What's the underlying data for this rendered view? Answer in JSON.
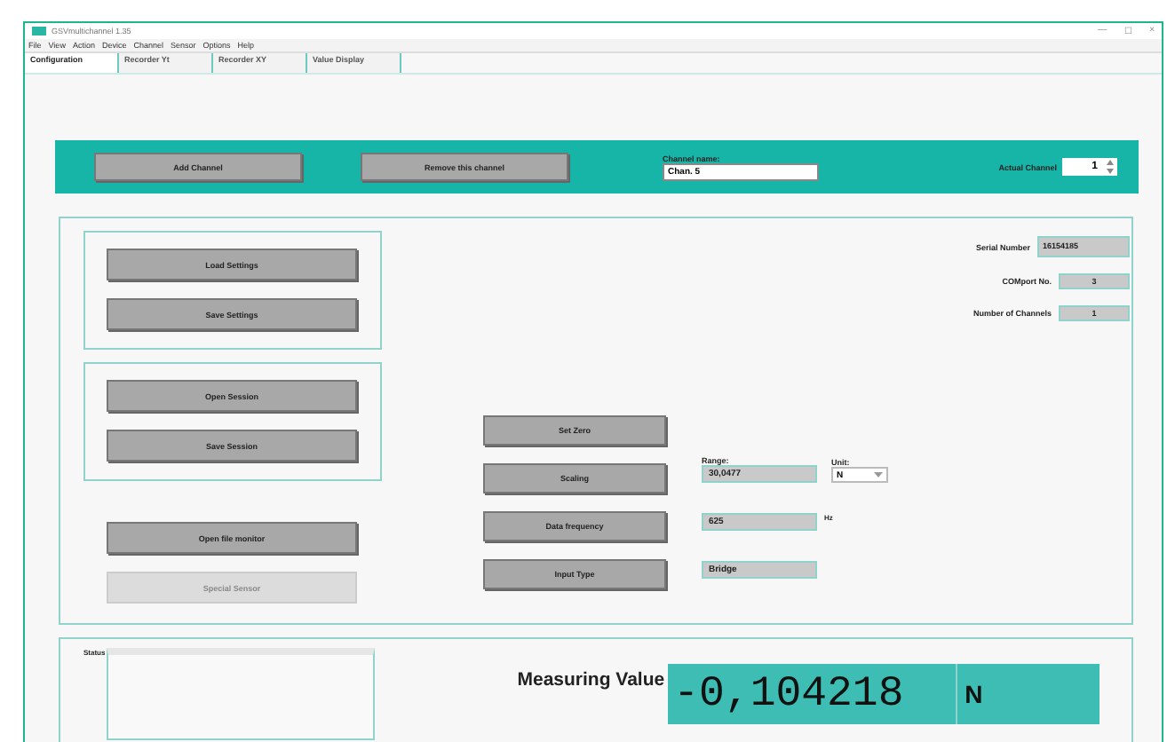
{
  "window": {
    "title": "GSVmultichannel 1.35",
    "controls": [
      "—",
      "☐",
      "×"
    ]
  },
  "menu": [
    "File",
    "View",
    "Action",
    "Device",
    "Channel",
    "Sensor",
    "Options",
    "Help"
  ],
  "tabs": [
    {
      "label": "Configuration",
      "selected": true
    },
    {
      "label": "Recorder Yt",
      "selected": false
    },
    {
      "label": "Recorder XY",
      "selected": false
    },
    {
      "label": "Value Display",
      "selected": false
    }
  ],
  "channel_bar": {
    "buttons": [
      "Add Channel",
      "Remove this channel"
    ],
    "channel_name": {
      "label": "Channel name:",
      "value": "Chan. 5"
    },
    "actual_channel": {
      "label": "Actual Channel",
      "value": "1"
    }
  },
  "settings": {
    "groups": [
      {
        "buttons": [
          {
            "label": "Load Settings",
            "disabled": false
          },
          {
            "label": "Save Settings",
            "disabled": false
          }
        ]
      },
      {
        "buttons": [
          {
            "label": "Open Session",
            "disabled": false
          },
          {
            "label": "Save Session",
            "disabled": false
          }
        ]
      }
    ],
    "buttons": [
      {
        "label": "Open file monitor",
        "disabled": false
      },
      {
        "label": "Special Sensor",
        "disabled": true
      }
    ]
  },
  "device_info": [
    {
      "label": "Serial Number",
      "value": "16154185"
    },
    {
      "label": "COMport No.",
      "value": "3"
    },
    {
      "label": "Number of Channels",
      "value": "1"
    }
  ],
  "sensor": {
    "rows": [
      {
        "button": "Set Zero"
      },
      {
        "button": "Scaling",
        "field_label": "Range:",
        "value": "30,0477",
        "unit_label": "Unit:",
        "unit": "N"
      },
      {
        "button": "Data frequency",
        "value": "625",
        "suffix": "Hz"
      },
      {
        "button": "Input Type",
        "value": "Bridge"
      }
    ]
  },
  "status": {
    "label": "Status"
  },
  "measuring": {
    "label": "Measuring Value",
    "value": "-0,104218",
    "unit": "N"
  }
}
